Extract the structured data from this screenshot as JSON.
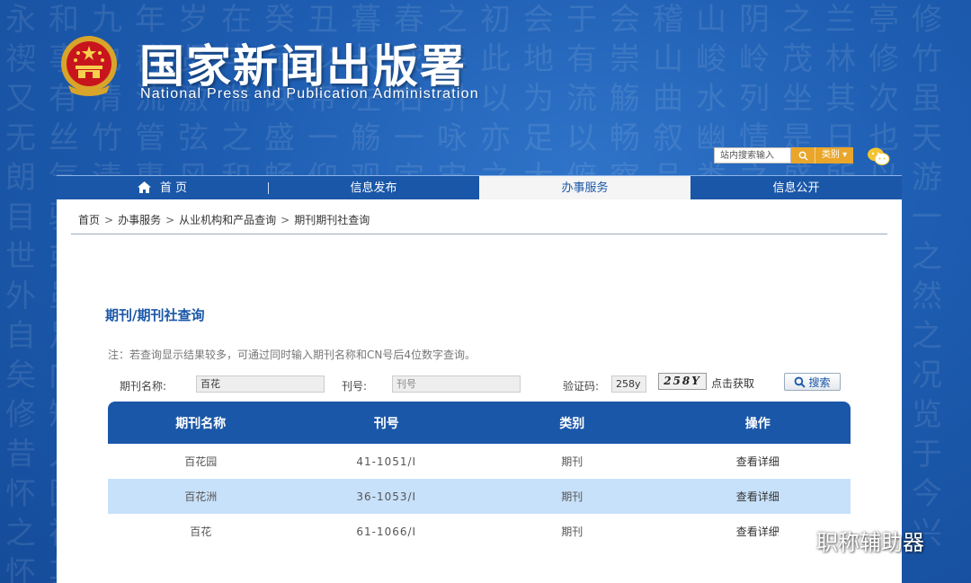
{
  "header": {
    "title": "国家新闻出版署",
    "subtitle": "National  Press and Publication Administration",
    "search_placeholder": "站内搜索输入",
    "category_label": "类别 ▾",
    "emblem_icon": "national-emblem-icon"
  },
  "nav": {
    "items": [
      {
        "label": "首 页",
        "icon": "home-icon"
      },
      {
        "label": "信息发布"
      },
      {
        "label": "办事服务",
        "active": true
      },
      {
        "label": "信息公开"
      }
    ]
  },
  "breadcrumb": [
    "首页",
    "办事服务",
    "从业机构和产品查询",
    "期刊期刊社查询"
  ],
  "breadcrumb_sep": ">",
  "section_title": "期刊/期刊社查询",
  "note": "注：若查询显示结果较多，可通过同时输入期刊名称和CN号后4位数字查询。",
  "form": {
    "name_label": "期刊名称:",
    "name_value": "百花",
    "cn_label": "刊号:",
    "cn_placeholder": "刊号",
    "captcha_label": "验证码:",
    "captcha_value": "258y",
    "captcha_image_text": "258Y",
    "refresh_label": "点击获取",
    "search_button": "搜索"
  },
  "table": {
    "headers": [
      "期刊名称",
      "刊号",
      "类别",
      "操作"
    ],
    "rows": [
      {
        "name": "百花园",
        "cn": "41-1051/I",
        "type": "期刊",
        "action": "查看详细"
      },
      {
        "name": "百花洲",
        "cn": "36-1053/I",
        "type": "期刊",
        "action": "查看详细"
      },
      {
        "name": "百花",
        "cn": "61-1066/I",
        "type": "期刊",
        "action": "查看详细"
      }
    ]
  },
  "watermark": "职称辅助器",
  "colors": {
    "primary": "#1a57a8",
    "accent": "#e9a62a",
    "highlight_row": "#c8e1fa"
  }
}
